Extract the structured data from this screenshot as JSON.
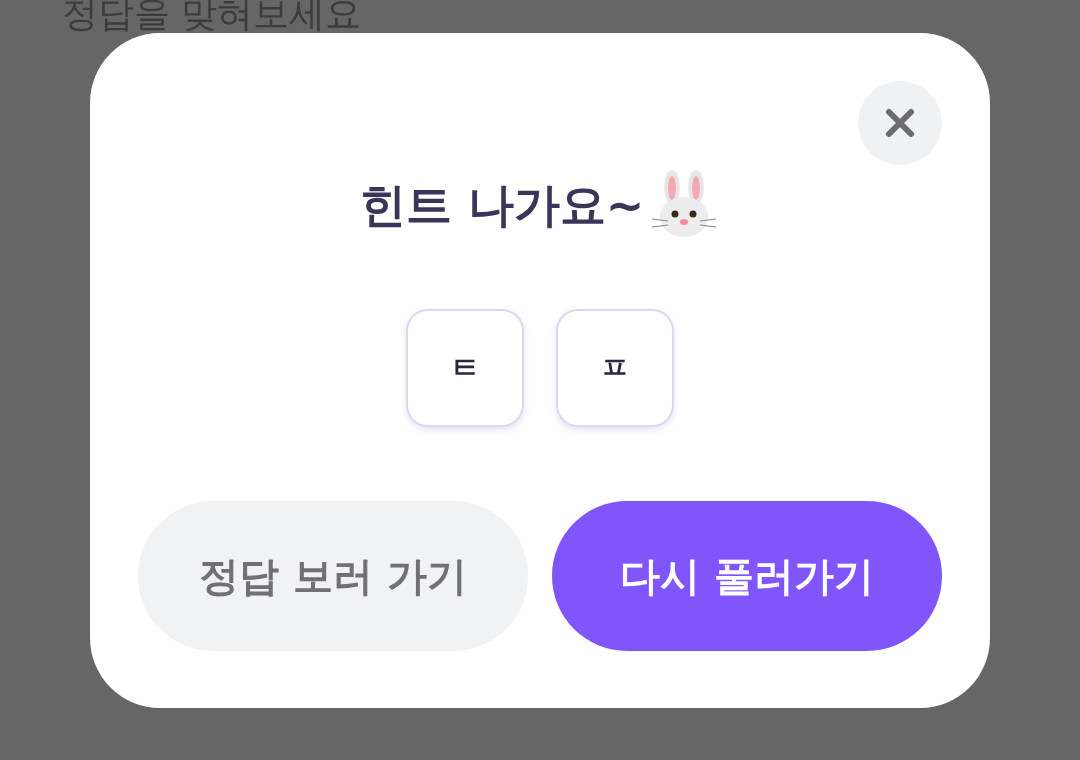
{
  "background": {
    "instruction": "정답을 맞혀보세요"
  },
  "dialog": {
    "title": "힌트 나가요~",
    "hints": [
      "ㅌ",
      "ㅍ"
    ],
    "buttons": [
      {
        "label": "정답 보러 가기",
        "kind": "secondary"
      },
      {
        "label": "다시 풀러가기",
        "kind": "primary"
      }
    ]
  }
}
